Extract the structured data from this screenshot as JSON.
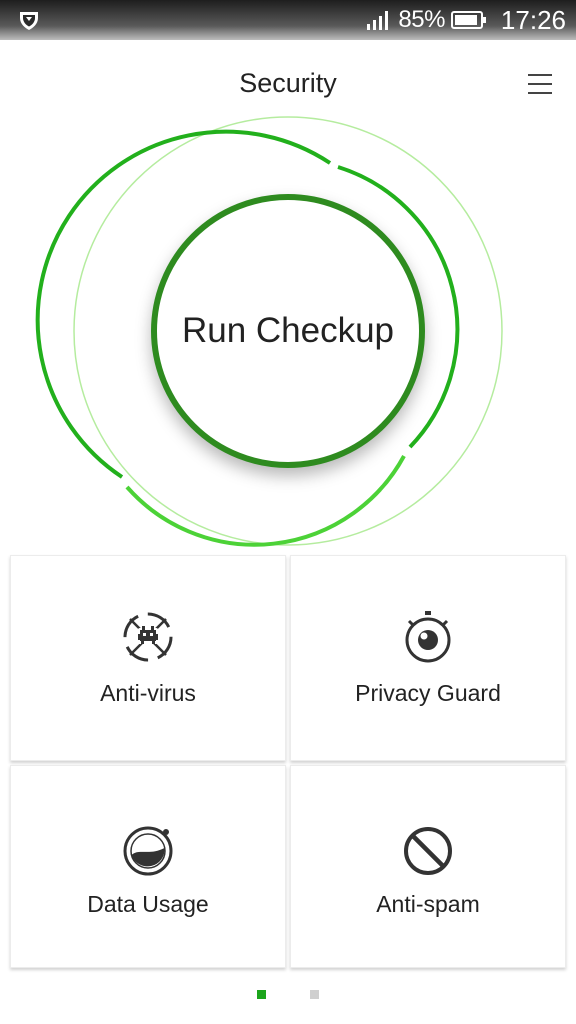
{
  "status_bar": {
    "battery_percent": "85%",
    "time": "17:26",
    "icons": [
      "shield-icon",
      "signal-icon",
      "battery-icon"
    ]
  },
  "header": {
    "title": "Security",
    "menu_icon": "hamburger-menu-icon"
  },
  "checkup": {
    "label": "Run Checkup"
  },
  "features": [
    {
      "label": "Anti-virus",
      "icon": "virus-icon"
    },
    {
      "label": "Privacy Guard",
      "icon": "eye-timer-icon"
    },
    {
      "label": "Data Usage",
      "icon": "data-gauge-icon"
    },
    {
      "label": "Anti-spam",
      "icon": "block-icon"
    }
  ],
  "pager": {
    "pages": 2,
    "active": 1
  },
  "colors": {
    "ring_dark": "#2e8b1f",
    "ring_mid": "#22b01c",
    "ring_light": "#b5ec9f",
    "pager_active": "#1ca51c",
    "pager_inactive": "#cfcfcf",
    "icon_dark": "#333333"
  }
}
